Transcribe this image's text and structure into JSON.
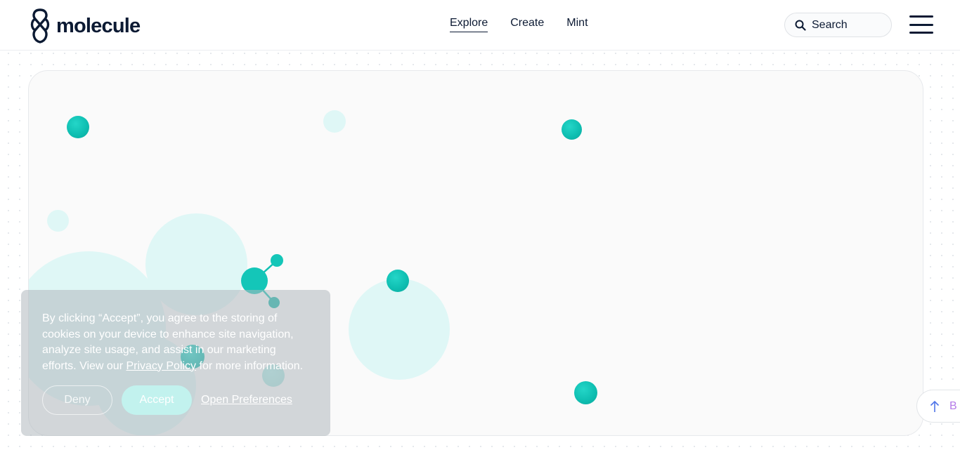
{
  "header": {
    "logo_text": "molecule",
    "nav": [
      {
        "label": "Explore",
        "active": true
      },
      {
        "label": "Create",
        "active": false
      },
      {
        "label": "Mint",
        "active": false
      }
    ],
    "search": {
      "placeholder": "Search",
      "value": ""
    }
  },
  "cookie_banner": {
    "text_before_link": "By clicking “Accept”, you agree to the storing of cookies on your device to enhance site navigation, analyze site usage, and assist in our marketing efforts. View our ",
    "link_text": "Privacy Policy",
    "text_after_link": " for more information.",
    "deny_label": "Deny",
    "accept_label": "Accept",
    "preferences_label": "Open Preferences"
  },
  "back_to_top": {
    "label": "B"
  },
  "icons": {
    "search": "search-icon",
    "menu": "hamburger-menu-icon",
    "back_top": "arrow-up-icon",
    "logo": "molecule-logo-icon"
  },
  "colors": {
    "brand_dark": "#0c1a33",
    "accent_teal": "#0fbfb2",
    "accent_light": "#dff7f6",
    "back_top_text": "#b57be8"
  }
}
